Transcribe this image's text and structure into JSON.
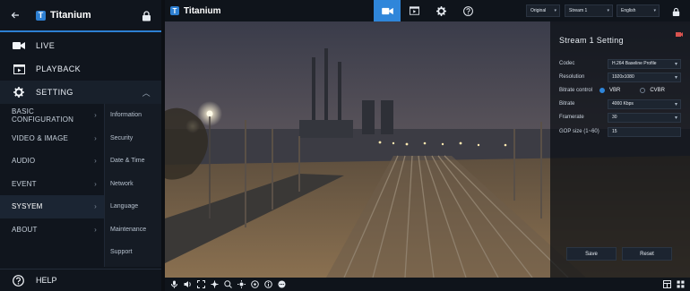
{
  "app": {
    "name": "Titanium",
    "logo_letter": "T"
  },
  "mobile": {
    "main_menu": [
      {
        "label": "LIVE",
        "icon": "video-camera-icon"
      },
      {
        "label": "PLAYBACK",
        "icon": "playback-icon"
      },
      {
        "label": "SETTING",
        "icon": "gear-icon",
        "active": true
      }
    ],
    "setting_categories": [
      "BASIC CONFIGURATION",
      "VIDEO & IMAGE",
      "AUDIO",
      "EVENT",
      "SYSYEM",
      "ABOUT"
    ],
    "selected_category": "SYSYEM",
    "system_submenu": [
      "Information",
      "Security",
      "Date & Time",
      "Network",
      "Language",
      "Maintenance",
      "Support"
    ],
    "help_label": "HELP"
  },
  "desktop": {
    "selects": {
      "view": "Original",
      "stream": "Stream 1",
      "language": "English"
    },
    "stream_setting": {
      "title": "Stream 1 Setting",
      "fields": {
        "codec": {
          "label": "Codec",
          "value": "H.264 Baseline Profile"
        },
        "resolution": {
          "label": "Resolution",
          "value": "1920x1080"
        },
        "bitrate_control": {
          "label": "Bitrate control",
          "options": [
            "VBR",
            "CVBR"
          ],
          "selected": "VBR"
        },
        "bitrate": {
          "label": "Bitrate",
          "value": "4000 Kbps"
        },
        "framerate": {
          "label": "Framerate",
          "value": "30"
        },
        "gop": {
          "label": "GOP size (1~60)",
          "value": "15"
        }
      },
      "save_label": "Save",
      "reset_label": "Reset"
    }
  },
  "colors": {
    "accent": "#2f86da",
    "sidebar_bg": "#10151d",
    "panel_bg": "#0a0e14"
  }
}
